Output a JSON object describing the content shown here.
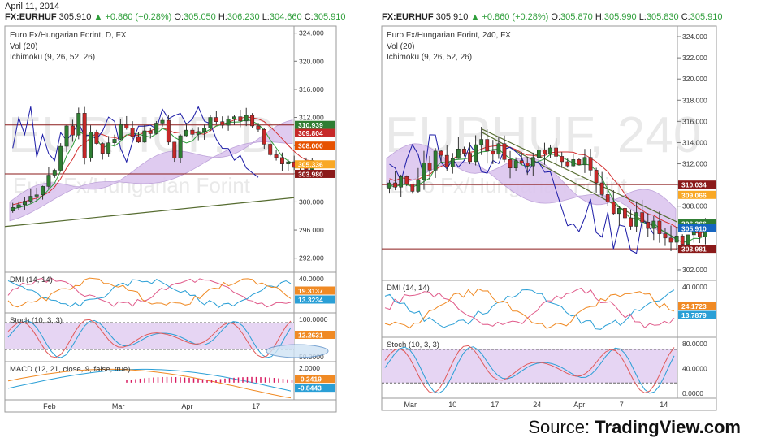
{
  "date": "April 11, 2014",
  "left_header": {
    "symbol": "FX:EURHUF",
    "last": "305.910",
    "change": "▲ +0.860 (+0.28%)",
    "o_label": "O:",
    "o": "305.050",
    "h_label": "H:",
    "h": "306.230",
    "l_label": "L:",
    "l": "304.660",
    "c_label": "C:",
    "c": "305.910"
  },
  "right_header": {
    "symbol": "FX:EURHUF",
    "last": "305.910",
    "change": "▲ +0.860 (+0.28%)",
    "o_label": "O:",
    "o": "305.870",
    "h_label": "H:",
    "h": "305.990",
    "l_label": "L:",
    "l": "305.830",
    "c_label": "C:",
    "c": "305.910"
  },
  "source_label": "Source:",
  "source_name": "TradingView.com",
  "chart_data": [
    {
      "type": "candlestick",
      "panel": "left",
      "title": "Euro Fx/Hungarian Forint, D, FX",
      "studies": [
        "Vol (20)",
        "Ichimoku (9, 26, 52, 26)"
      ],
      "watermark": "EURHUF, D",
      "watermark_sub": "Euro Fx/Hungarian Forint",
      "ylim": [
        290,
        325
      ],
      "yticks": [
        "324.000",
        "320.000",
        "316.000",
        "312.000",
        "308.000",
        "304.000",
        "300.000",
        "296.000",
        "292.000"
      ],
      "ytick_values": [
        324,
        320,
        316,
        312,
        308,
        304,
        300,
        296,
        292
      ],
      "xticks": [
        "Feb",
        "Mar",
        "Apr",
        "17"
      ],
      "price_labels": [
        {
          "text": "310.939",
          "value": 310.939,
          "color": "#2e7d32"
        },
        {
          "text": "309.804",
          "value": 309.804,
          "color": "#c62828"
        },
        {
          "text": "308.000",
          "value": 308.0,
          "color": "#e65100"
        },
        {
          "text": "305.336",
          "value": 305.336,
          "color": "#f9a825"
        },
        {
          "text": "303.980",
          "value": 303.98,
          "color": "#8b1a1a"
        }
      ],
      "closes": [
        299.2,
        299.6,
        300.1,
        300.8,
        301.0,
        302.2,
        303.8,
        304.5,
        307.9,
        310.8,
        309.5,
        312.6,
        306.2,
        309.9,
        308.3,
        306.9,
        308.4,
        308.9,
        311.0,
        310.5,
        309.3,
        308.5,
        310.1,
        309.7,
        311.2,
        311.6,
        308.5,
        306.2,
        309.4,
        310.2,
        309.6,
        310.0,
        310.5,
        312.0,
        311.4,
        310.9,
        311.8,
        312.1,
        311.5,
        312.3,
        310.8,
        310.3,
        308.2,
        306.7,
        306.3,
        305.4,
        305.7,
        304.9,
        305.2,
        304.6,
        305.9
      ],
      "dmi": {
        "title": "DMI (14, 14)",
        "labels": [
          "19.3137",
          "13.3234"
        ],
        "yticks": [
          "40.0000"
        ]
      },
      "stoch": {
        "title": "Stoch (10, 3, 3)",
        "labels": [
          "12.2631"
        ],
        "yticks": [
          "100.0000",
          "50.0000"
        ]
      },
      "macd": {
        "title": "MACD (12, 21, close, 9, false, true)",
        "labels": [
          "-0.2419",
          "-0.8443"
        ],
        "yticks": [
          "2.0000"
        ]
      }
    },
    {
      "type": "candlestick",
      "panel": "right",
      "title": "Euro Fx/Hungarian Forint, 240, FX",
      "studies": [
        "Vol (20)",
        "Ichimoku (9, 26, 52, 26)"
      ],
      "watermark": "EURHUF, 240",
      "watermark_sub": "Euro Fx/Hungarian Forint",
      "ylim": [
        301,
        325
      ],
      "yticks": [
        "324.000",
        "322.000",
        "320.000",
        "318.000",
        "316.000",
        "314.000",
        "312.000",
        "310.000",
        "308.000",
        "306.000",
        "304.000",
        "302.000"
      ],
      "ytick_values": [
        324,
        322,
        320,
        318,
        316,
        314,
        312,
        310,
        308,
        306,
        304,
        302
      ],
      "xticks": [
        "Mar",
        "10",
        "17",
        "24",
        "Apr",
        "7",
        "14"
      ],
      "price_labels": [
        {
          "text": "310.034",
          "value": 310.034,
          "color": "#8b1a1a"
        },
        {
          "text": "309.066",
          "value": 309.066,
          "color": "#f9a825"
        },
        {
          "text": "306.366",
          "value": 306.366,
          "color": "#2e7d32"
        },
        {
          "text": "305.910",
          "value": 305.91,
          "color": "#1565c0"
        },
        {
          "text": "303.981",
          "value": 303.981,
          "color": "#8b1a1a"
        }
      ],
      "closes": [
        310.2,
        309.8,
        310.8,
        310.1,
        309.4,
        310.5,
        312.1,
        311.4,
        313.2,
        312.8,
        311.7,
        312.5,
        313.4,
        313.0,
        312.2,
        313.8,
        314.3,
        313.2,
        312.9,
        313.9,
        312.4,
        311.6,
        312.3,
        312.1,
        311.8,
        312.6,
        313.3,
        312.9,
        313.5,
        312.7,
        312.2,
        311.8,
        312.4,
        311.9,
        312.6,
        311.4,
        310.2,
        309.1,
        308.4,
        307.3,
        307.8,
        306.9,
        306.1,
        307.4,
        306.5,
        305.9,
        306.6,
        305.4,
        305.0,
        304.6,
        305.2,
        304.4,
        305.3,
        305.8,
        305.1,
        305.9
      ],
      "dmi": {
        "title": "DMI (14, 14)",
        "labels": [
          "24.1723",
          "13.7879"
        ],
        "yticks": [
          "40.0000"
        ]
      },
      "stoch": {
        "title": "Stoch (10, 3, 3)",
        "labels": [],
        "yticks": [
          "80.0000",
          "40.0000",
          "0.0000"
        ]
      }
    }
  ]
}
